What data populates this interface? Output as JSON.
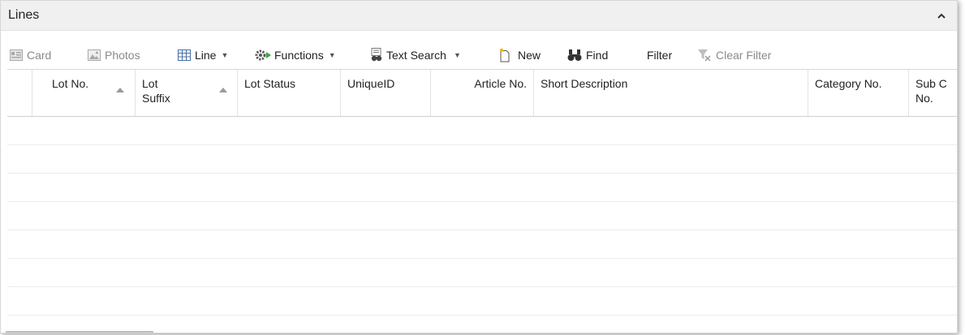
{
  "panel": {
    "title": "Lines",
    "collapse_icon": "chevron-up-icon"
  },
  "toolbar": {
    "card_label": "Card",
    "photos_label": "Photos",
    "line_label": "Line",
    "functions_label": "Functions",
    "text_search_label": "Text Search",
    "new_label": "New",
    "find_label": "Find",
    "filter_label": "Filter",
    "clear_filter_label": "Clear Filter"
  },
  "grid": {
    "columns": [
      {
        "line1": "Lot No.",
        "line2": ""
      },
      {
        "line1": "Lot",
        "line2": "Suffix"
      },
      {
        "line1": "Lot Status",
        "line2": ""
      },
      {
        "line1": "UniqueID",
        "line2": ""
      },
      {
        "line1": "Article No.",
        "line2": ""
      },
      {
        "line1": "Short Description",
        "line2": ""
      },
      {
        "line1": "Category No.",
        "line2": ""
      },
      {
        "line1": "Sub C",
        "line2": "No."
      }
    ],
    "empty_rows": 7
  }
}
